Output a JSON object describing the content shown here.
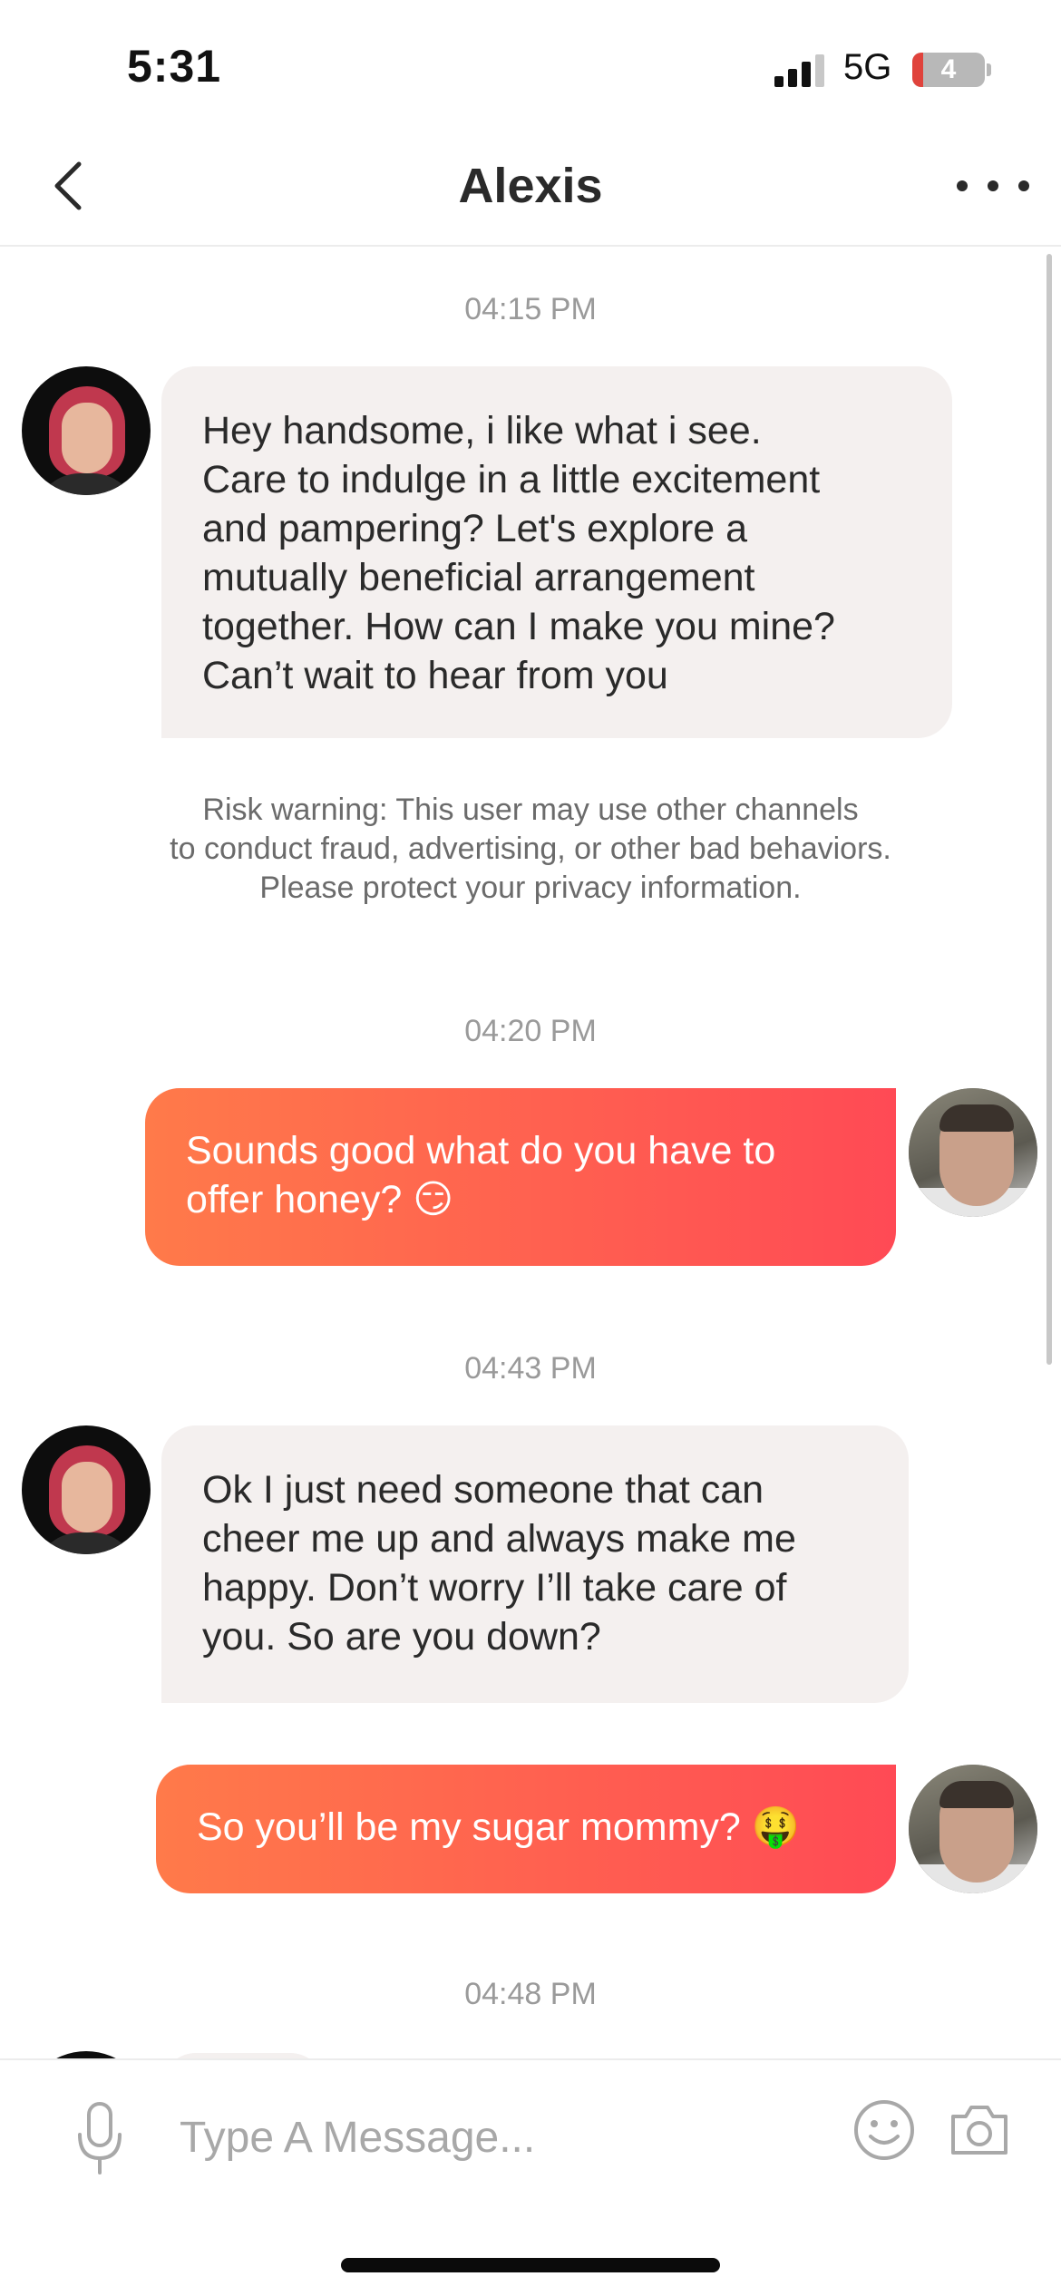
{
  "status_bar": {
    "time": "5:31",
    "network": "5G",
    "battery_level": "4"
  },
  "header": {
    "title": "Alexis",
    "back_icon": "chevron-left-icon",
    "more_icon": "more-horizontal-icon"
  },
  "messages": [
    {
      "type": "timestamp",
      "text": "04:15 PM"
    },
    {
      "type": "incoming",
      "sender": "Alexis",
      "text": "Hey handsome, i like what i see.\nCare to indulge in a little excitement\nand pampering? Let's explore a\nmutually beneficial arrangement\ntogether. How can I make you mine?\nCan’t wait to hear from you"
    },
    {
      "type": "notice",
      "text": "Risk warning: This user may use other channels\nto conduct fraud, advertising, or other bad behaviors.\nPlease protect your privacy information."
    },
    {
      "type": "timestamp",
      "text": "04:20 PM"
    },
    {
      "type": "outgoing",
      "text": "Sounds good what do you have to\noffer honey? 😏"
    },
    {
      "type": "timestamp",
      "text": "04:43 PM"
    },
    {
      "type": "incoming",
      "sender": "Alexis",
      "text": "Ok I just need someone that can\ncheer me up and always make me\nhappy. Don’t worry I’ll take care of\nyou. So are you down?"
    },
    {
      "type": "outgoing",
      "text": "So you’ll be my sugar mommy? 🤑"
    },
    {
      "type": "timestamp",
      "text": "04:48 PM"
    }
  ],
  "input_bar": {
    "placeholder": "Type A Message...",
    "mic_icon": "microphone-icon",
    "emoji_icon": "smiley-icon",
    "camera_icon": "camera-icon"
  },
  "colors": {
    "outgoing_gradient_start": "#ff7a4a",
    "outgoing_gradient_end": "#ff4a55",
    "incoming_bubble": "#f4f0ef",
    "timestamp_text": "#9a9a9a"
  }
}
